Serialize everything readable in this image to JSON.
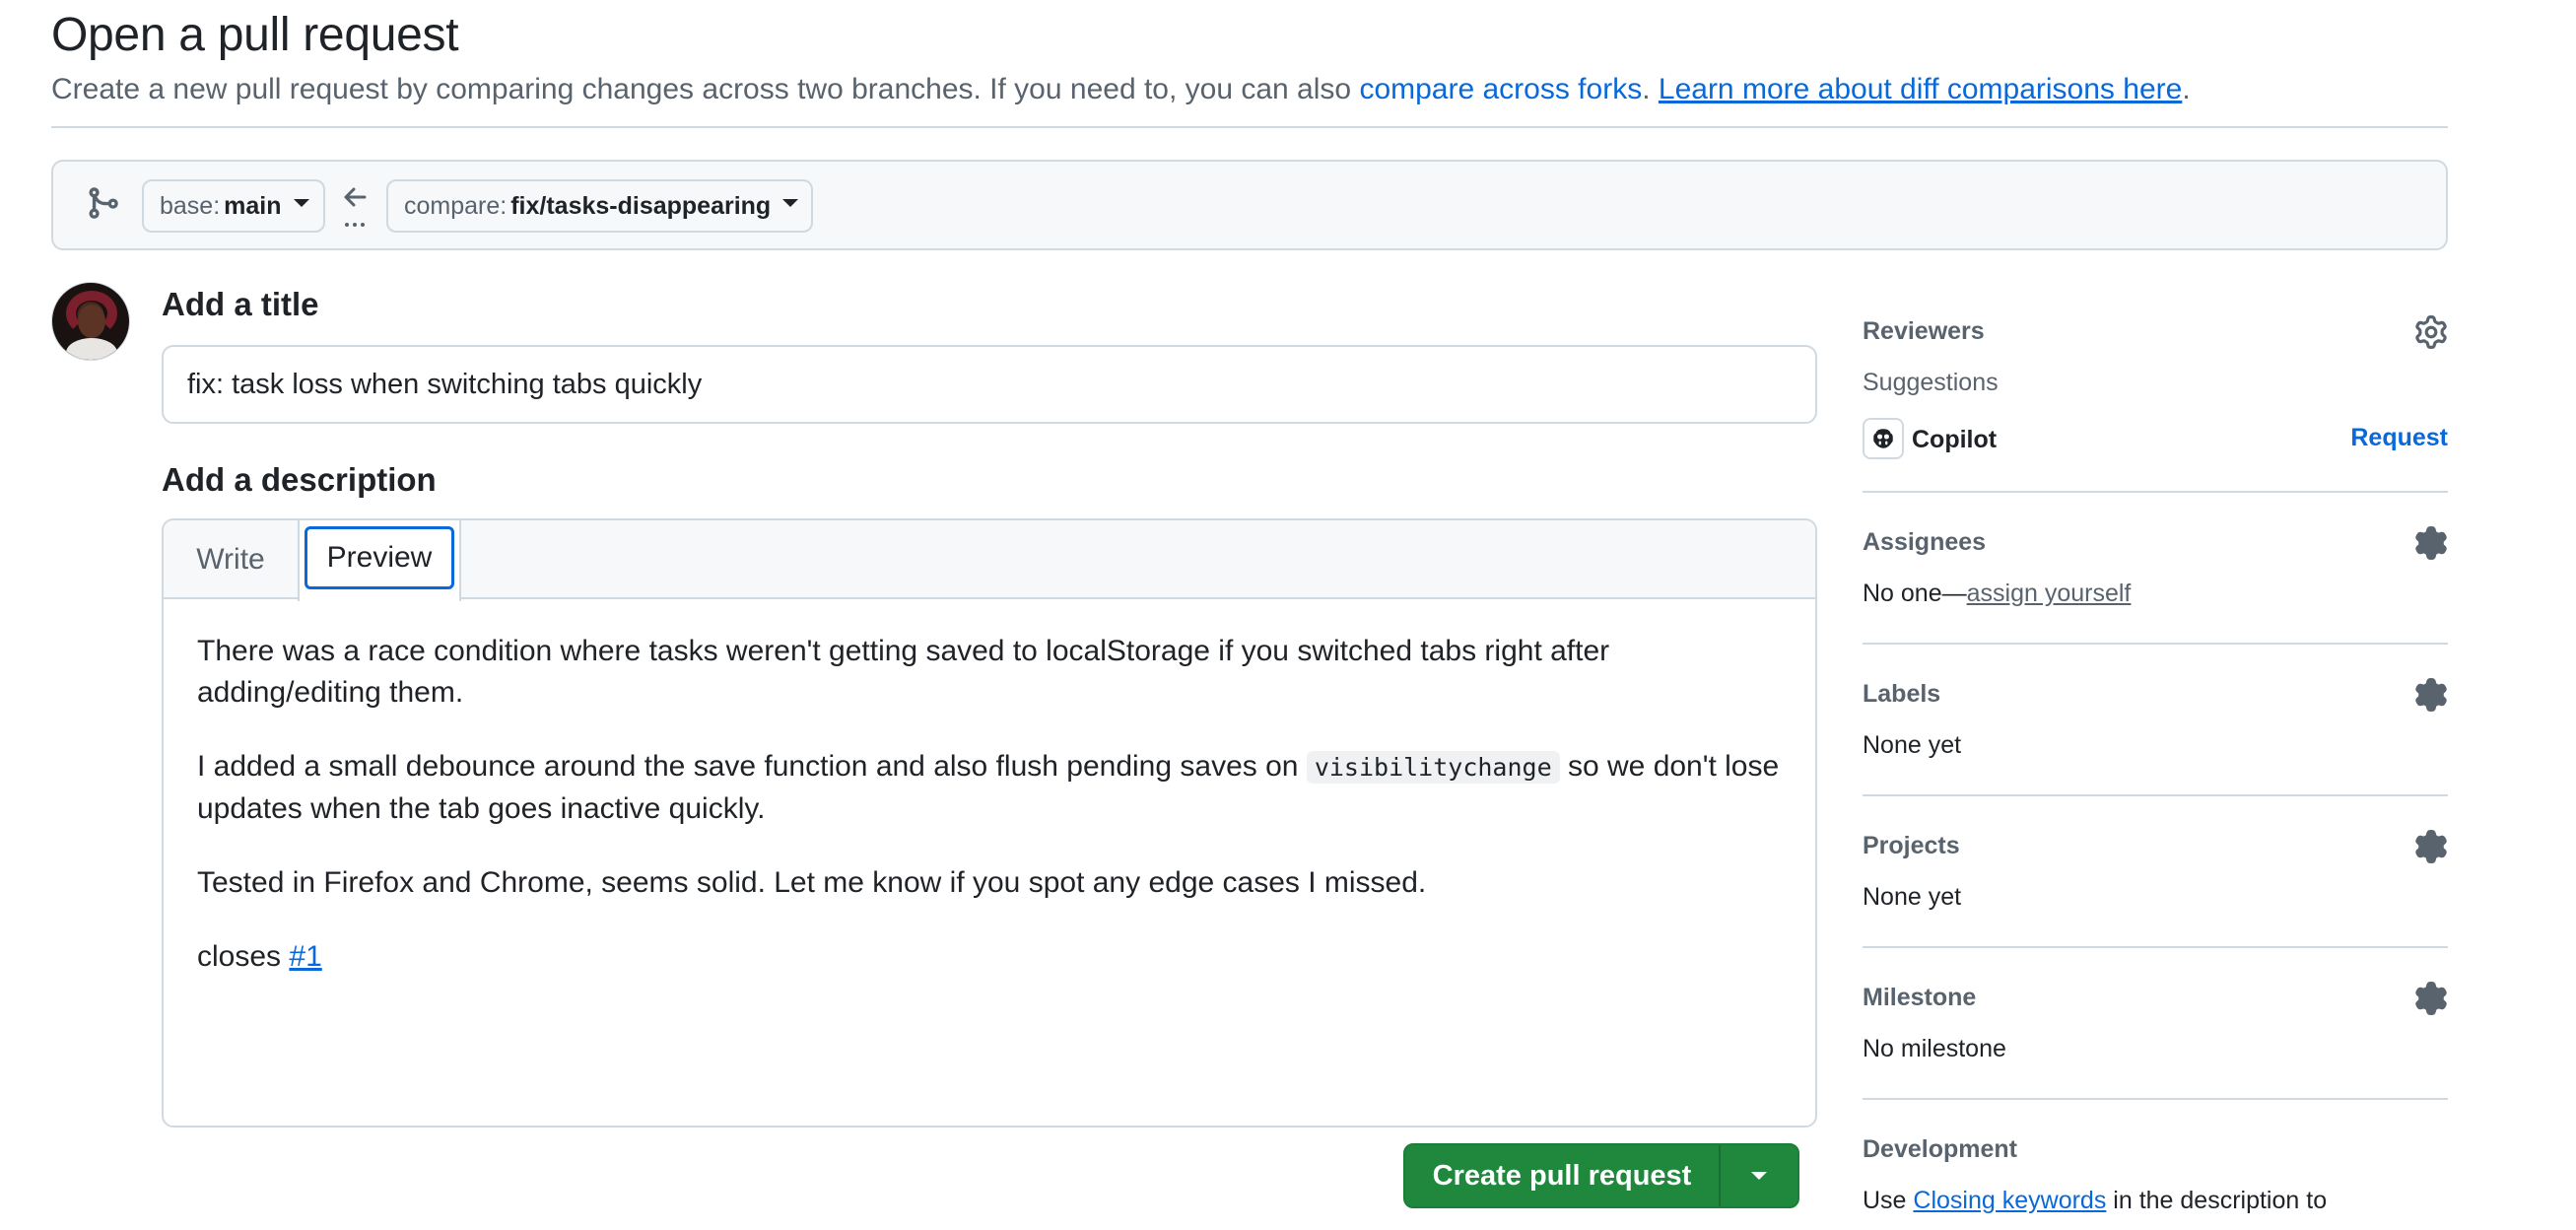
{
  "header": {
    "title": "Open a pull request",
    "subtitle_prefix": "Create a new pull request by comparing changes across two branches. If you need to, you can also",
    "compare_forks_link": "compare across forks",
    "period1": ".",
    "learn_more_link": "Learn more about diff comparisons here",
    "period2": "."
  },
  "range": {
    "base_key": "base:",
    "base_value": "main",
    "compare_key": "compare:",
    "compare_value": "fix/tasks-disappearing"
  },
  "form": {
    "title_label": "Add a title",
    "title_value": "fix: task loss when switching tabs quickly",
    "description_label": "Add a description",
    "tab_write": "Write",
    "tab_preview": "Preview",
    "preview": {
      "p1": "There was a race condition where tasks weren't getting saved to localStorage if you switched tabs right after adding/editing them.",
      "p2_before": "I added a small debounce around the save function and also flush pending saves on",
      "p2_code": "visibilitychange",
      "p2_after": "so we don't lose updates when the tab goes inactive quickly.",
      "p3": "Tested in Firefox and Chrome, seems solid. Let me know if you spot any edge cases I missed.",
      "p4_prefix": "closes",
      "p4_link": "#1"
    },
    "create_button": "Create pull request"
  },
  "sidebar": {
    "reviewers": {
      "title": "Reviewers",
      "suggestions": "Suggestions",
      "copilot": "Copilot",
      "request": "Request"
    },
    "assignees": {
      "title": "Assignees",
      "text_prefix": "No one—",
      "assign_link": "assign yourself"
    },
    "labels": {
      "title": "Labels",
      "value": "None yet"
    },
    "projects": {
      "title": "Projects",
      "value": "None yet"
    },
    "milestone": {
      "title": "Milestone",
      "value": "No milestone"
    },
    "development": {
      "title": "Development",
      "text_prefix": "Use",
      "link": "Closing keywords",
      "text_suffix": "in the description to"
    }
  },
  "colors": {
    "accent": "#0969da",
    "create_button": "#1f883d",
    "border": "#d1d9e0",
    "muted_text": "#59636e"
  }
}
